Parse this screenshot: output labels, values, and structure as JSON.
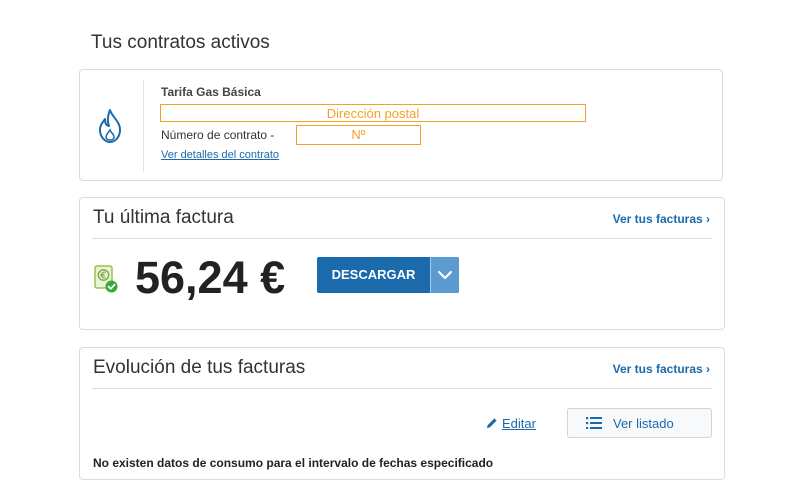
{
  "contracts": {
    "section_title": "Tus contratos activos",
    "tariff_name": "Tarifa Gas Básica",
    "address_placeholder": "Dirección postal",
    "contract_number_label": "Número de contrato -",
    "contract_number_placeholder": "Nº",
    "details_link": "Ver detalles del contrato",
    "icon": "flame-icon"
  },
  "last_invoice": {
    "title": "Tu última factura",
    "link": "Ver tus facturas ›",
    "amount": "56,24 €",
    "download_label": "DESCARGAR",
    "icon": "euro-bill-check-icon"
  },
  "evolution": {
    "title": "Evolución de tus facturas",
    "link": "Ver tus facturas ›",
    "edit_label": "Editar",
    "list_label": "Ver listado",
    "no_data_message": "No existen datos de consumo para el intervalo de fechas especificado"
  },
  "colors": {
    "accent": "#1a6aac",
    "highlight": "#f2a22a",
    "success": "#3aa935",
    "border": "#d6dde3"
  }
}
